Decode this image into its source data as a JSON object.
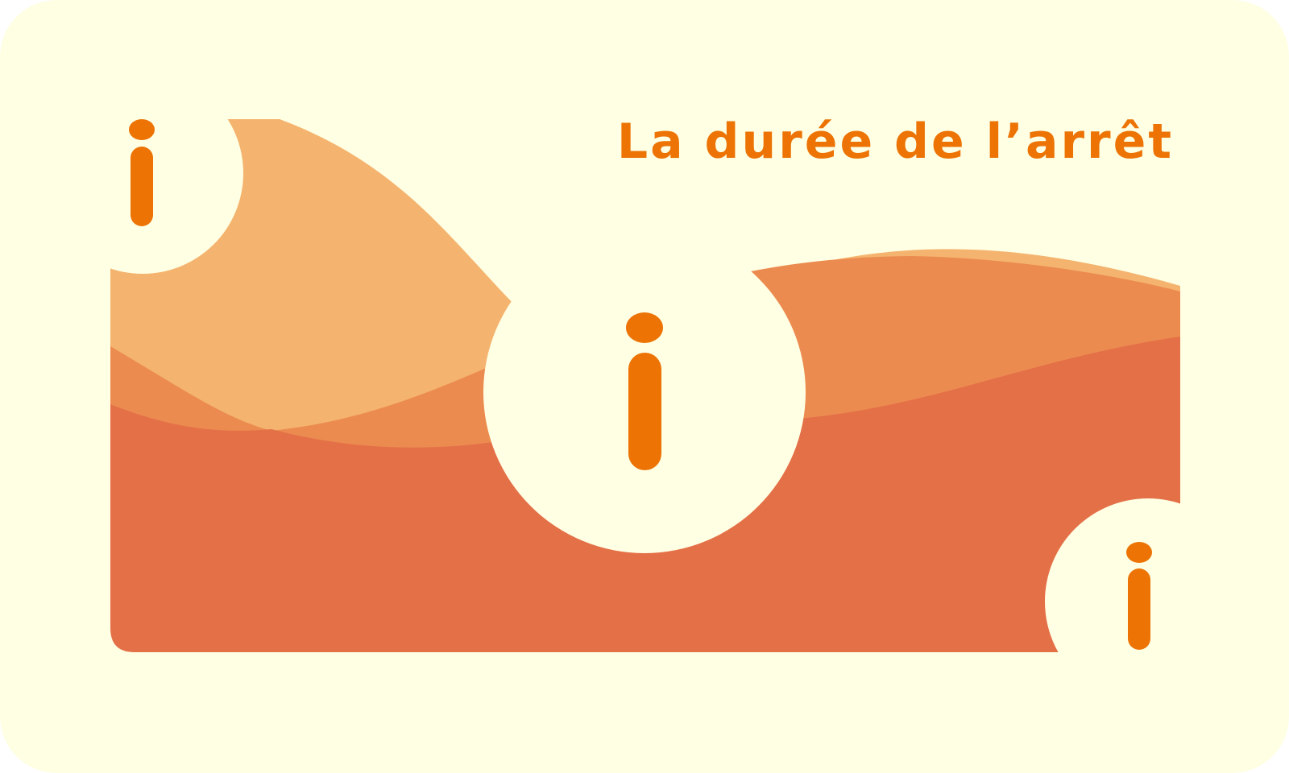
{
  "title": "La durée de l’arrêt",
  "icons": [
    "info-icon",
    "info-icon",
    "info-icon"
  ],
  "colors": {
    "background": "#FFFFE3",
    "wave_light": "#F4B46F",
    "wave_mid": "#EC8B50",
    "wave_dark": "#E47048",
    "accent": "#EC7304"
  }
}
